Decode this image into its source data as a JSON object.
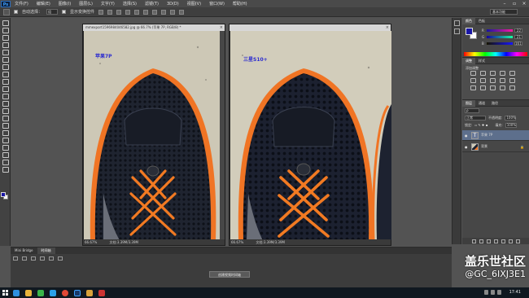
{
  "app": {
    "logo": "Ps",
    "menu": [
      "文件(F)",
      "编辑(E)",
      "图像(I)",
      "图层(L)",
      "文字(Y)",
      "选择(S)",
      "滤镜(T)",
      "3D(D)",
      "视图(V)",
      "窗口(W)",
      "帮助(H)"
    ],
    "window_controls": [
      "–",
      "▫",
      "×"
    ]
  },
  "options_bar": {
    "auto_select_label": "自动选择：",
    "auto_select_value": "组",
    "show_transform_label": "显示变换控件",
    "workspace": "基本功能"
  },
  "documents": [
    {
      "title": "mmexport1596984046582.jpg @ 66.7% (苹果 7P, RGB/8) *",
      "photo_label": "苹果7P",
      "zoom": "66.67%",
      "doc_size": "文档:3.39M/3.39M"
    },
    {
      "title": "",
      "photo_label": "三星S10+",
      "zoom": "66.67%",
      "doc_size": "文档:3.39M/3.39M"
    }
  ],
  "right_panel": {
    "color_tabs": [
      "颜色",
      "色板"
    ],
    "sliders": [
      {
        "label": "R",
        "value": "22",
        "color": "#e22"
      },
      {
        "label": "G",
        "value": "21",
        "color": "#2c2"
      },
      {
        "label": "B",
        "value": "161",
        "color": "#22e"
      }
    ],
    "adj_tabs": [
      "调整",
      "样式"
    ],
    "adj_title": "添加调整",
    "layers_tabs": [
      "图层",
      "通道",
      "路径"
    ],
    "blend_mode": "正常",
    "opacity_label": "不透明度:",
    "opacity": "100%",
    "lock_label": "锁定:",
    "fill_label": "填充:",
    "fill": "100%",
    "layers": [
      {
        "name": "苹果 7P",
        "type": "T",
        "selected": true
      },
      {
        "name": "背景",
        "type": "img",
        "selected": false
      }
    ]
  },
  "bottom_panel": {
    "tabs": [
      "Mini Bridge",
      "时间轴"
    ],
    "create_button": "创建视频时间轴"
  },
  "taskbar": {
    "clock": "17:41",
    "icons": [
      {
        "name": "ie",
        "color": "#2d8fe0"
      },
      {
        "name": "explorer",
        "color": "#e8b33a"
      },
      {
        "name": "wechat",
        "color": "#3bb54a"
      },
      {
        "name": "qq",
        "color": "#2aa0e8"
      },
      {
        "name": "chrome",
        "color": "#e04836"
      },
      {
        "name": "photoshop",
        "color": "#1a3a6a"
      },
      {
        "name": "folder",
        "color": "#d9a23a"
      },
      {
        "name": "media",
        "color": "#cc3333"
      }
    ]
  },
  "watermark": {
    "title": "盖乐世社区",
    "user": "@GC_6IXJ3E1"
  }
}
